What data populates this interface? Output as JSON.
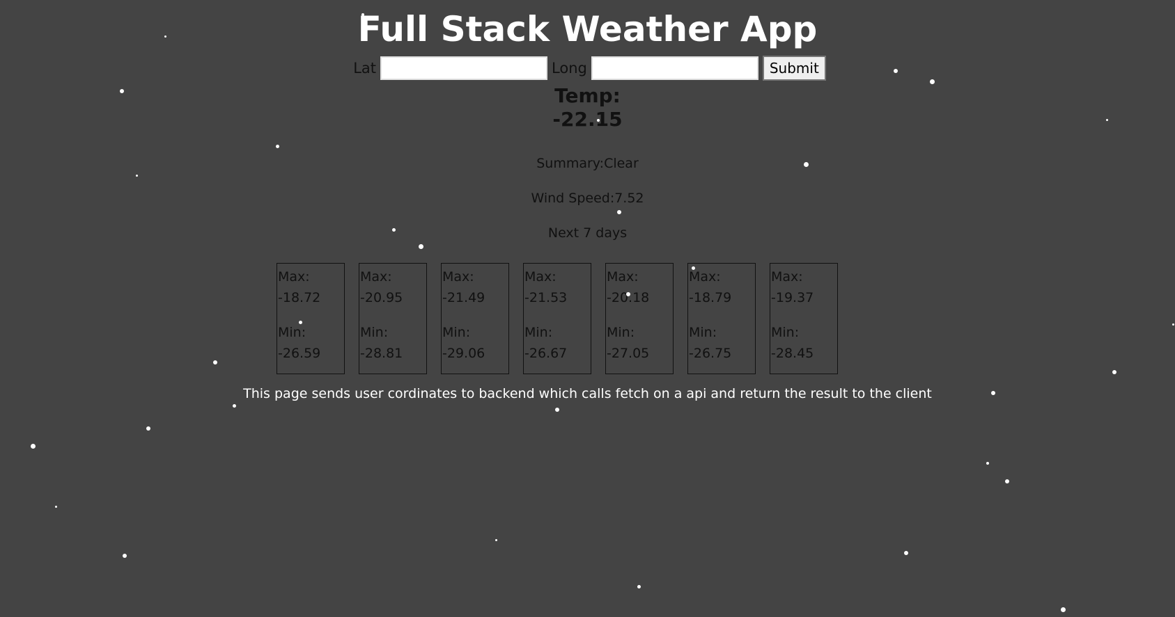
{
  "app": {
    "title": "Full Stack Weather App"
  },
  "form": {
    "lat_label": "Lat",
    "lat_value": "",
    "long_label": "Long",
    "long_value": "",
    "submit_label": "Submit"
  },
  "current": {
    "temp_label": "Temp:",
    "temp_value": "-22.15",
    "summary": "Summary:Clear",
    "wind_speed": "Wind Speed:7.52"
  },
  "forecast": {
    "heading": "Next 7 days",
    "max_label": "Max:",
    "min_label": "Min:",
    "days": [
      {
        "max": "-18.72",
        "min": "-26.59"
      },
      {
        "max": "-20.95",
        "min": "-28.81"
      },
      {
        "max": "-21.49",
        "min": "-29.06"
      },
      {
        "max": "-21.53",
        "min": "-26.67"
      },
      {
        "max": "-20.18",
        "min": "-27.05"
      },
      {
        "max": "-18.79",
        "min": "-26.75"
      },
      {
        "max": "-19.37",
        "min": "-28.45"
      }
    ]
  },
  "footer": {
    "note": "This page sends user cordinates to backend which calls fetch on a api and return the result to the client"
  },
  "theme": {
    "background": "#444444",
    "snow": "#ffffff"
  }
}
